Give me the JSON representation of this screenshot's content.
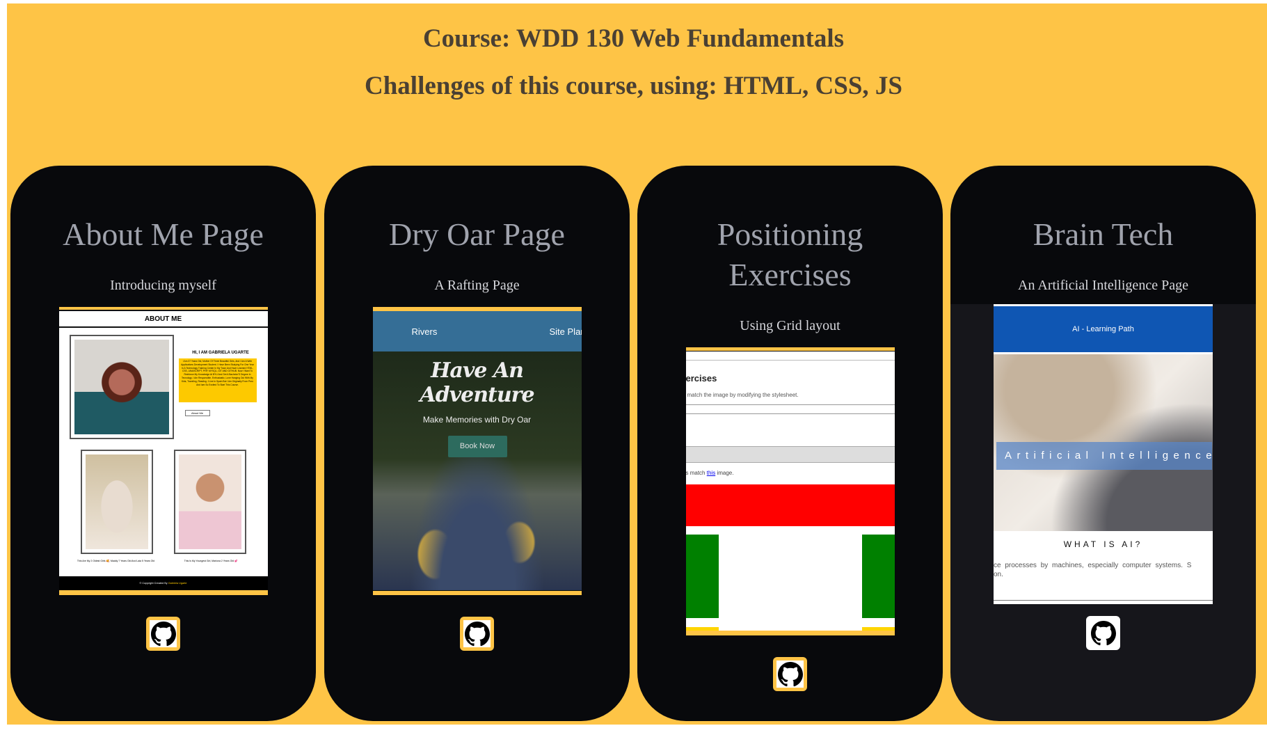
{
  "header": {
    "title": "Course: WDD 130 Web Fundamentals",
    "subtitle": "Challenges of this course, using: HTML, CSS, JS"
  },
  "colors": {
    "background": "#fec446",
    "card": "#08090c",
    "card_title": "#a0a3ad",
    "heading": "#4a4033"
  },
  "cards": [
    {
      "title": "About Me Page",
      "subtitle": "Introducing myself",
      "icon": "github-icon",
      "preview": {
        "header": "ABOUT ME",
        "name": "HI, I AM GABRIELA UGARTE",
        "bio": "I Am 37 Years Old, Mother Of Three Beautiful Girls, And I Am A Web Applications Development Student. I Have Been Studying For One Year In A Technology Training Center In My Town And Have Learned HTML, CSS, JAVASCRIPT, PHP, MYSQL, GIT AND GITHUB. Now I Want To Reinforce My Knowledge At BYU And Get A Bachelor'S Degree In Tecnology. I Am Responsible, Enthusiastic, Love Hanging Out With My Kids, Traveling, Reading. I Live In Spain But I Am Originally From Perú And Iam So Excited To Start This Course.",
        "button": "About Me",
        "caption1": "This Are My 2 Oldest Girls 🥰, Maddy 7 Years Old And Laia 5 Years Old",
        "caption2": "This Is My Youngest Girl, Mariona 2 Years Old 💕",
        "footer": "© Copyright Created By",
        "footer_name": "Gabriela Ugarte"
      }
    },
    {
      "title": "Dry Oar Page",
      "subtitle": "A Rafting Page",
      "icon": "github-icon",
      "preview": {
        "nav": [
          "Rivers",
          "Site Plan"
        ],
        "hero": "Have An Adventure",
        "tagline": "Make Memories with Dry Oar",
        "button": "Book Now"
      }
    },
    {
      "title": "Positioning Exercises",
      "subtitle": "Using Grid layout",
      "icon": "github-icon",
      "preview": {
        "heading": "ercises",
        "instructions": "match the image by modifying the stylesheet.",
        "note_pre": "s match",
        "link": "this",
        "note_post": "image."
      }
    },
    {
      "title": "Brain Tech",
      "subtitle": "An Artificial Intelligence Page",
      "icon": "github-icon",
      "preview": {
        "nav": "AI - Learning Path",
        "banner": "Artificial Intelligence",
        "heading": "WHAT IS AI?",
        "text1": "ce processes by machines, especially computer systems. S",
        "text2": "on."
      }
    }
  ]
}
